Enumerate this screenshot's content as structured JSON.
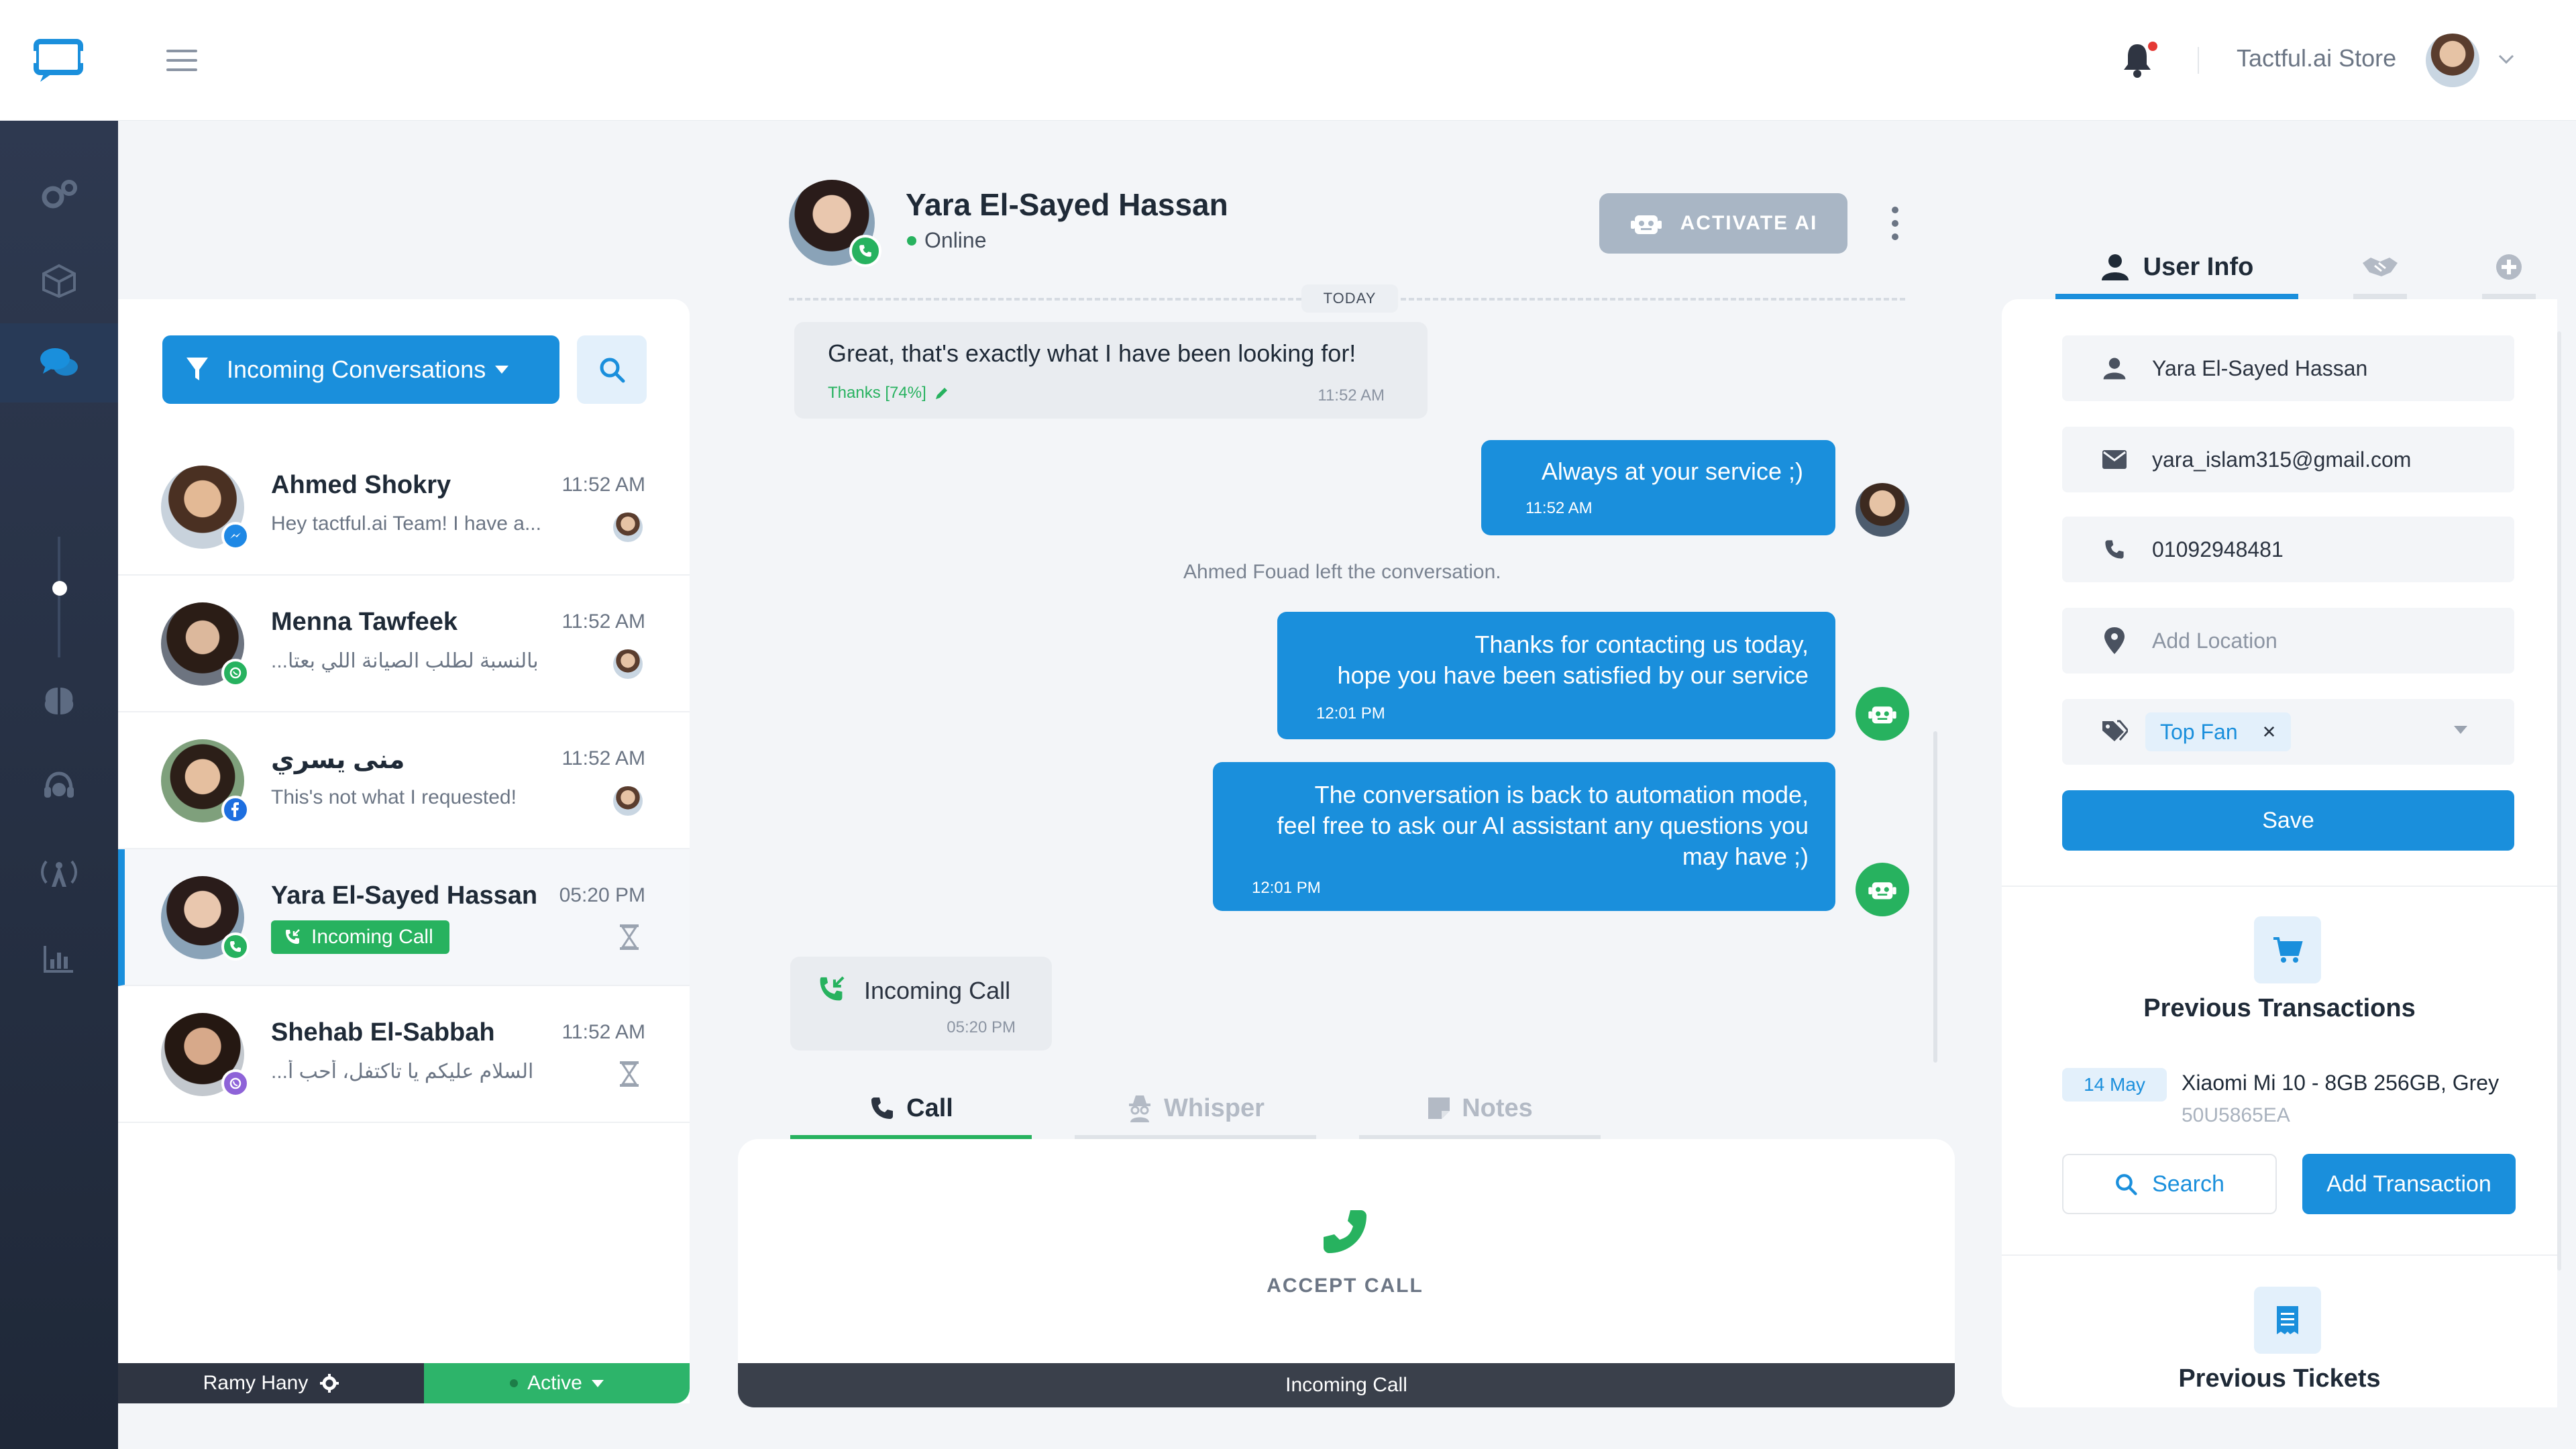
{
  "topbar": {
    "store_name": "Tactful.ai Store",
    "notification_icon": "bell-icon",
    "menu_icon": "hamburger-icon"
  },
  "sidebar": {
    "items": [
      {
        "icon": "gears-icon",
        "active": false
      },
      {
        "icon": "cube-icon",
        "active": false
      },
      {
        "icon": "chat-bubbles-icon",
        "active": true
      },
      {
        "icon": "brain-icon",
        "active": false
      },
      {
        "icon": "headset-icon",
        "active": false
      },
      {
        "icon": "broadcast-icon",
        "active": false
      },
      {
        "icon": "bar-chart-icon",
        "active": false
      }
    ]
  },
  "conversations": {
    "filter_label": "Incoming Conversations",
    "list": [
      {
        "name": "Ahmed Shokry",
        "time": "11:52 AM",
        "preview": "Hey tactful.ai Team! I have a...",
        "channel": "messenger",
        "channel_color": "#1e88e5",
        "status_icon": "agent-avatar"
      },
      {
        "name": "Menna Tawfeek",
        "time": "11:52 AM",
        "preview": "بالنسبة لطلب الصيانة اللي بعتا...",
        "channel": "whatsapp",
        "channel_color": "#27b25f",
        "status_icon": "agent-avatar"
      },
      {
        "name": "منى يسري",
        "time": "11:52 AM",
        "preview": "This's not what I requested!",
        "channel": "facebook",
        "channel_color": "#1e6fe0",
        "status_icon": "agent-avatar"
      },
      {
        "name": "Yara El-Sayed Hassan",
        "time": "05:20 PM",
        "preview": "",
        "tag": "Incoming Call",
        "channel": "phone",
        "channel_color": "#27b25f",
        "status_icon": "hourglass-icon",
        "selected": true
      },
      {
        "name": "Shehab El-Sabbah",
        "time": "11:52 AM",
        "preview": "السلام عليكم يا تاكتفل، أحب أ...",
        "channel": "viber",
        "channel_color": "#8e63d8",
        "status_icon": "hourglass-icon"
      }
    ],
    "agent_name": "Ramy Hany",
    "agent_status": "Active"
  },
  "chat": {
    "contact_name": "Yara El-Sayed Hassan",
    "status": "Online",
    "activate_ai_label": "ACTIVATE AI",
    "date_divider": "TODAY",
    "messages": [
      {
        "dir": "in",
        "text": "Great, that's exactly what I have been looking for!",
        "meta": "Thanks [74%]",
        "time": "11:52 AM"
      },
      {
        "dir": "out",
        "text": "Always at your service ;)",
        "time": "11:52 AM",
        "sender": "agent"
      },
      {
        "dir": "system",
        "text": "Ahmed Fouad left the conversation."
      },
      {
        "dir": "out",
        "lines": [
          "Thanks for contacting us today,",
          "hope you have been satisfied by our service"
        ],
        "time": "12:01 PM",
        "sender": "bot"
      },
      {
        "dir": "out",
        "lines": [
          "The conversation is back to automation mode,",
          "feel free to ask our AI assistant any questions you",
          "may have ;)"
        ],
        "time": "12:01 PM",
        "sender": "bot"
      }
    ],
    "call_bubble": {
      "label": "Incoming Call",
      "time": "05:20 PM"
    },
    "tabs": [
      {
        "label": "Call",
        "active": true,
        "icon": "phone-icon"
      },
      {
        "label": "Whisper",
        "active": false,
        "icon": "spy-icon"
      },
      {
        "label": "Notes",
        "active": false,
        "icon": "note-icon"
      }
    ],
    "accept_call_label": "ACCEPT CALL",
    "footer_label": "Incoming Call"
  },
  "user_info": {
    "tab_label": "User Info",
    "name": "Yara El-Sayed Hassan",
    "email": "yara_islam315@gmail.com",
    "phone": "01092948481",
    "location_placeholder": "Add Location",
    "tag": "Top Fan",
    "save_label": "Save",
    "transactions_title": "Previous Transactions",
    "transaction": {
      "date": "14 May",
      "name": "Xiaomi Mi 10 - 8GB 256GB, Grey",
      "code": "50U5865EA"
    },
    "search_label": "Search",
    "add_transaction_label": "Add Transaction",
    "tickets_title": "Previous Tickets"
  }
}
